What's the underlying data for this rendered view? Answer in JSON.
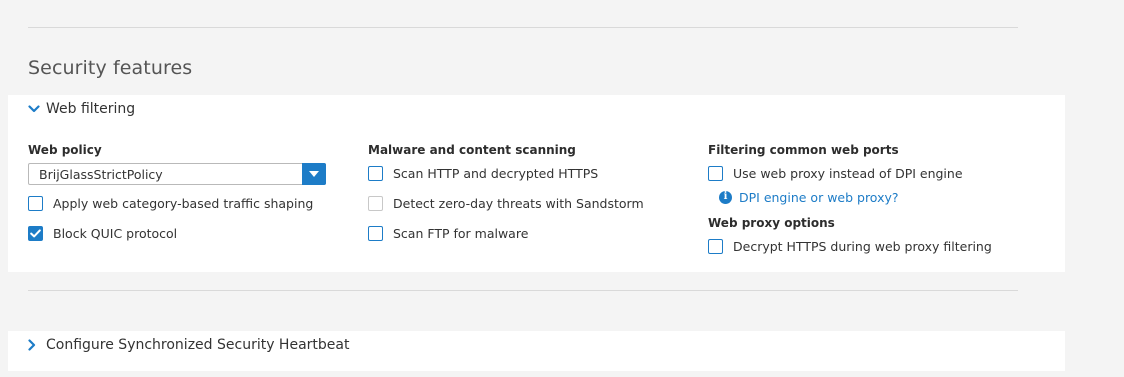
{
  "section_title": "Security features",
  "web_filtering": {
    "title": "Web filtering",
    "expanded": true,
    "web_policy": {
      "label": "Web policy",
      "selected": "BrijGlassStrictPolicy"
    },
    "col1_checkboxes": [
      {
        "label": "Apply web category-based traffic shaping",
        "checked": false
      },
      {
        "label": "Block QUIC protocol",
        "checked": true
      }
    ],
    "malware": {
      "label": "Malware and content scanning",
      "checkboxes": [
        {
          "label": "Scan HTTP and decrypted HTTPS",
          "checked": false
        },
        {
          "label": "Detect zero-day threats with Sandstorm",
          "checked": false,
          "disabled": true
        },
        {
          "label": "Scan FTP for malware",
          "checked": false
        }
      ]
    },
    "ports": {
      "label": "Filtering common web ports",
      "checkbox": {
        "label": "Use web proxy instead of DPI engine",
        "checked": false
      },
      "info_link": "DPI engine or web proxy?"
    },
    "proxy_options": {
      "label": "Web proxy options",
      "checkbox": {
        "label": "Decrypt HTTPS during web proxy filtering",
        "checked": false
      }
    }
  },
  "heartbeat": {
    "title": "Configure Synchronized Security Heartbeat",
    "expanded": false
  },
  "colors": {
    "accent": "#1d7cc7",
    "background": "#f4f4f4",
    "panel": "#ffffff"
  }
}
